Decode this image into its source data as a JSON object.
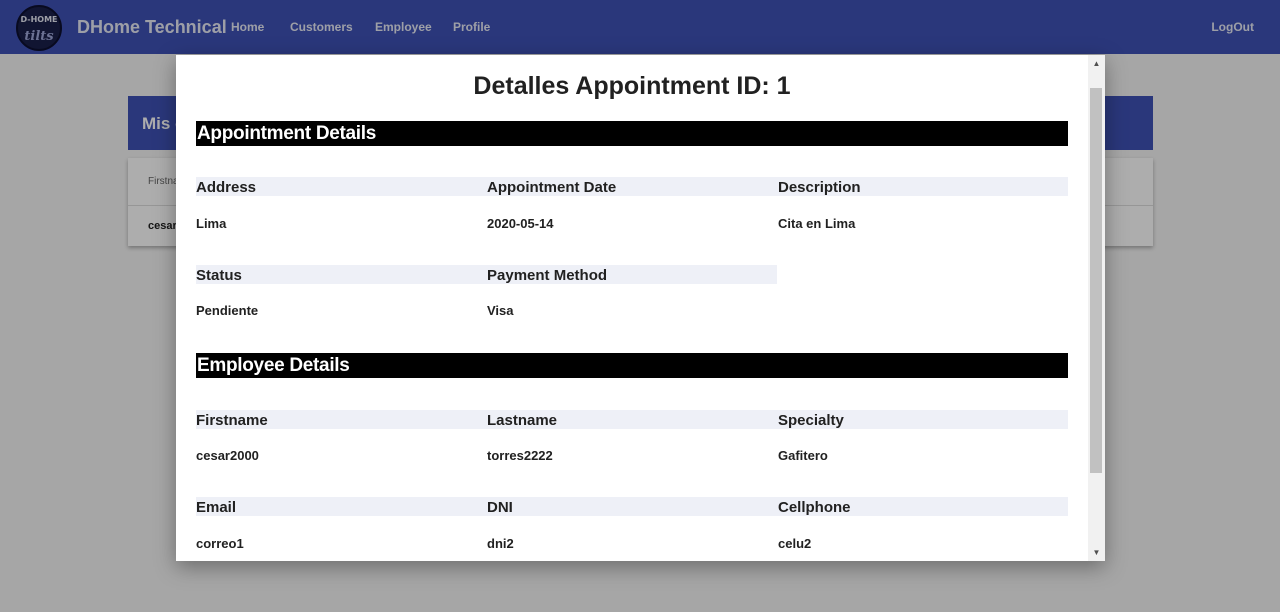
{
  "navbar": {
    "logo_text_top": "D-HOME",
    "logo_text_bottom": "tilts",
    "brand": "DHome Technical",
    "links": [
      "Home",
      "Customers",
      "Employee",
      "Profile"
    ],
    "logout": "LogOut"
  },
  "background_page": {
    "header_title": "Mis c",
    "table_header": "Firstna",
    "table_cell": "cesar"
  },
  "dialog": {
    "title": "Detalles Appointment ID: 1",
    "appointment_section": {
      "title": "Appointment Details",
      "fields": [
        {
          "label": "Address",
          "value": "Lima"
        },
        {
          "label": "Appointment Date",
          "value": "2020-05-14"
        },
        {
          "label": "Description",
          "value": "Cita en Lima"
        },
        {
          "label": "Status",
          "value": "Pendiente"
        },
        {
          "label": "Payment Method",
          "value": "Visa"
        }
      ]
    },
    "employee_section": {
      "title": "Employee Details",
      "fields": [
        {
          "label": "Firstname",
          "value": "cesar2000"
        },
        {
          "label": "Lastname",
          "value": "torres2222"
        },
        {
          "label": "Specialty",
          "value": "Gafitero"
        },
        {
          "label": "Email",
          "value": "correo1"
        },
        {
          "label": "DNI",
          "value": "dni2"
        },
        {
          "label": "Cellphone",
          "value": "celu2"
        }
      ]
    }
  },
  "colors": {
    "primary": "#3f51b5",
    "section_bar": "#000000",
    "label_strip": "#eef0f7"
  }
}
